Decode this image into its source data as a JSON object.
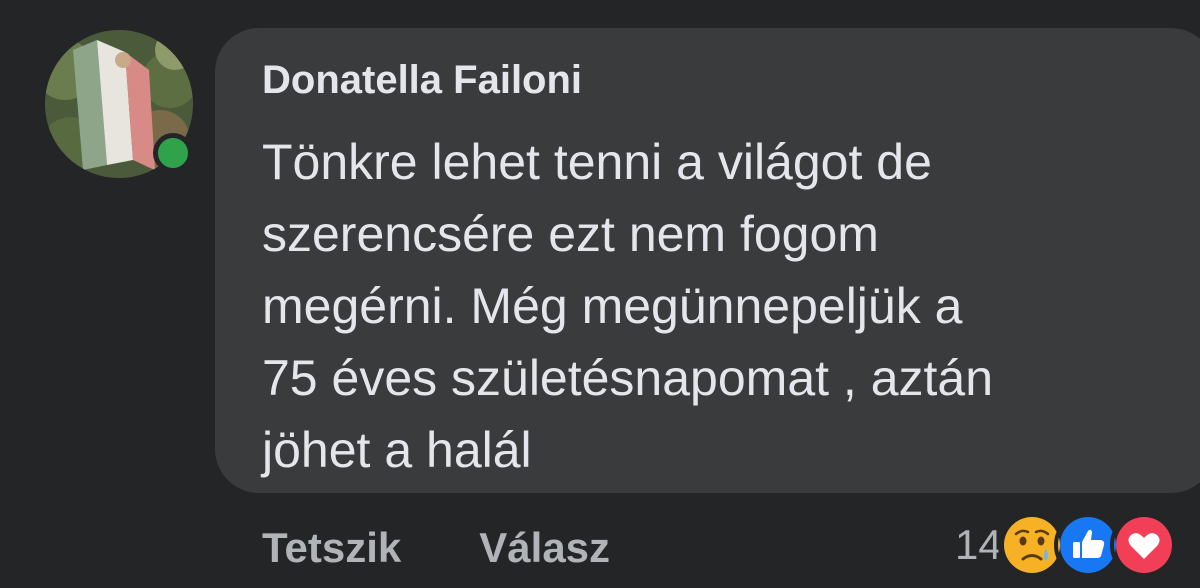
{
  "comment": {
    "author": "Donatella Failoni",
    "text": "Tönkre lehet tenni a világot de\nszerencsére ezt nem fogom\nmegérni. Még megünnepeljük a\n75 éves születésnapomat , aztán\njöhet a halál",
    "online": true
  },
  "actions": {
    "like_label": "Tetszik",
    "reply_label": "Válasz"
  },
  "reactions": {
    "count": "14",
    "icons": [
      "sad-icon",
      "like-icon",
      "love-icon"
    ]
  },
  "colors": {
    "background": "#242526",
    "bubble": "#3a3b3c",
    "text": "#e4e6eb",
    "secondary_text": "#b0b3b8",
    "online": "#31a24c",
    "like": "#1877f2",
    "love": "#f33e58",
    "sad": "#f7b125"
  }
}
